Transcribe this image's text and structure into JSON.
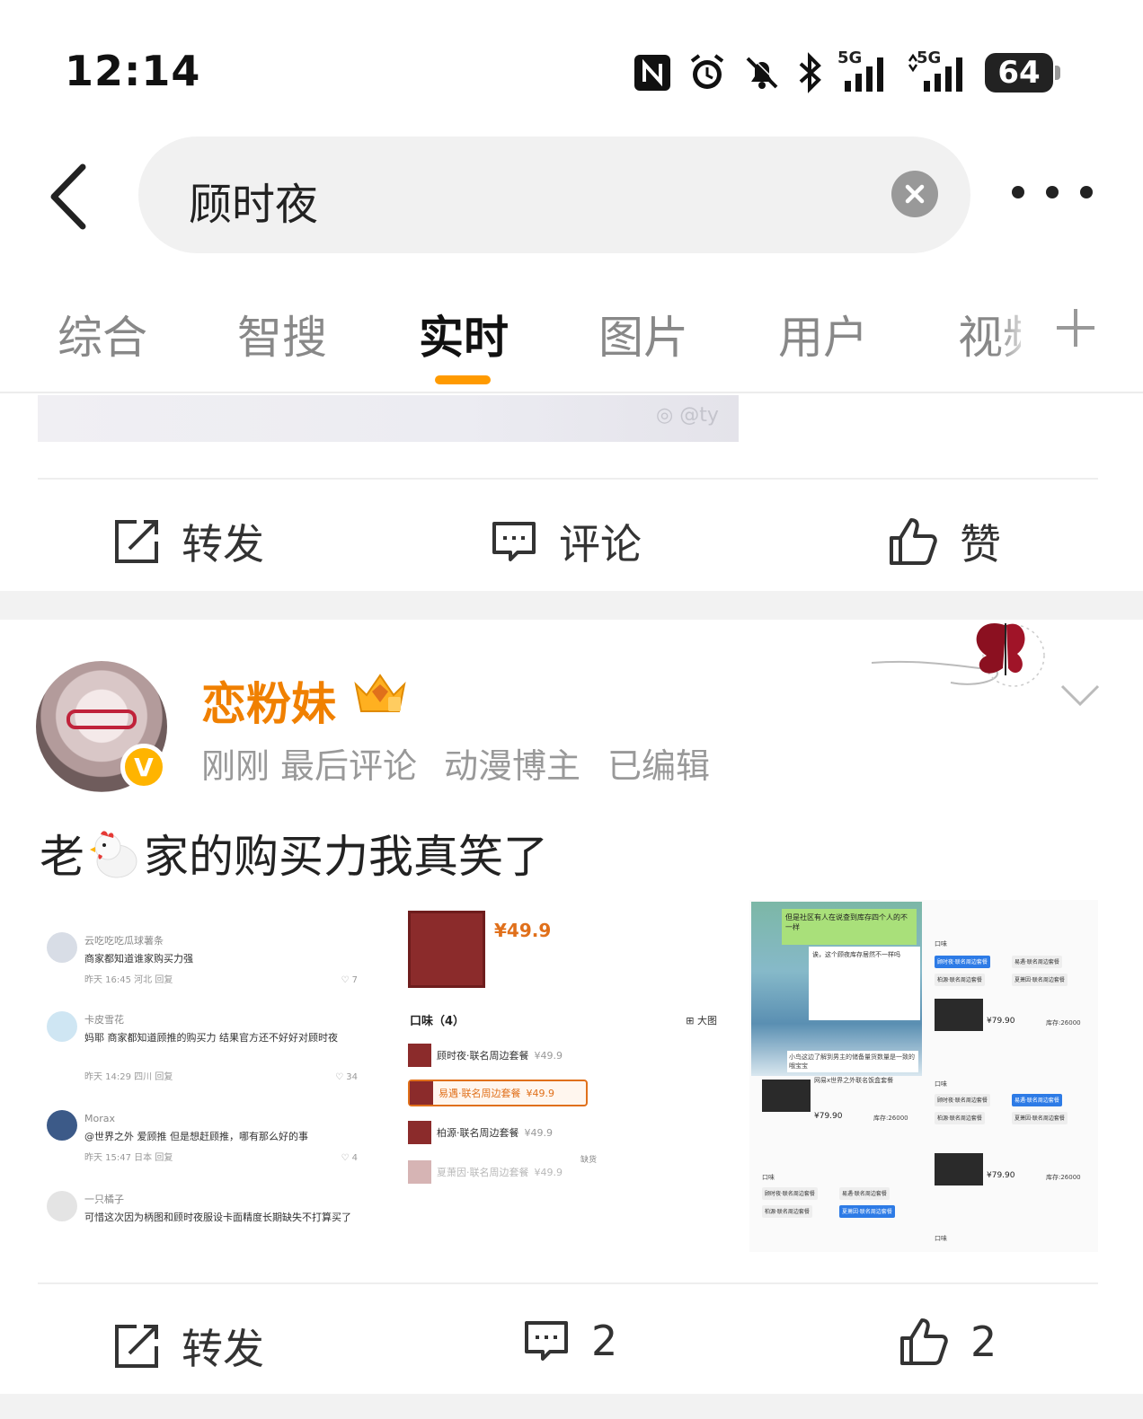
{
  "status_bar": {
    "time": "12:14",
    "icons": [
      "nfc-icon",
      "alarm-icon",
      "mute-icon",
      "bluetooth-icon",
      "signal-5g-icon",
      "signal-5g-data-icon"
    ],
    "network_1": "5G",
    "network_2": "5G",
    "battery": "64"
  },
  "search": {
    "query": "顾时夜"
  },
  "tabs": [
    {
      "label": "综合"
    },
    {
      "label": "智搜"
    },
    {
      "label": "实时",
      "active": true
    },
    {
      "label": "图片"
    },
    {
      "label": "用户"
    },
    {
      "label": "视频"
    }
  ],
  "accent_color": "#ff9a00",
  "previous_post": {
    "watermark": "@ty",
    "actions": {
      "repost": "转发",
      "comment": "评论",
      "like": "赞"
    }
  },
  "post": {
    "username": "恋粉妹",
    "username_color": "#f08000",
    "verified_badge": "V",
    "meta": {
      "time": "刚刚",
      "status": "最后评论",
      "role": "动漫博主",
      "edited": "已编辑"
    },
    "text_before": "老",
    "text_after": "家的购买力我真笑了",
    "emoji": "chicken-icon",
    "images": {
      "comments": [
        {
          "name": "云吃吃吃瓜球薯条",
          "body": "商家都知道谁家购买力强",
          "foot": "昨天 16:45 河北  回复",
          "likes": "7"
        },
        {
          "name": "卡皮雪花",
          "body": "妈耶 商家都知道顾推的购买力 结果官方还不好好对顾时夜",
          "foot": "昨天 14:29 四川  回复",
          "likes": "34"
        },
        {
          "name": "Morax",
          "body": "@世界之外 爱顾推 但是想赶顾推，哪有那么好的事",
          "foot": "昨天 15:47 日本  回复",
          "likes": "4"
        },
        {
          "name": "一只橘子",
          "body": "可惜这次因为柄图和顾时夜服设卡面精度长期缺失不打算买了",
          "foot": "",
          "likes": ""
        }
      ],
      "product": {
        "price": "¥49.9",
        "heading": "口味（4）",
        "big_view": "大图",
        "options": [
          {
            "label": "顾时夜·联名周边套餐",
            "price": "¥49.9"
          },
          {
            "label": "易遇·联名周边套餐",
            "price": "¥49.9"
          },
          {
            "label": "柏源·联名周边套餐",
            "price": "¥49.9"
          },
          {
            "label": "夏萧因·联名周边套餐",
            "price": "¥49.9"
          }
        ],
        "stock_note": "缺货"
      },
      "listing": {
        "bubble": "但是社区有人在说查到库存四个人的不一样",
        "card": "诶，这个顾夜库存居然不一样吗",
        "caption": "小鸟这边了解到男主的储备量货数量是一致的哦宝宝",
        "title": "网易x世界之外联名饭盒套餐",
        "price": "¥79.90",
        "stock": "库存:26000",
        "flavor": "口味",
        "tags": [
          "顾时夜·联名周边套餐",
          "易遇·联名周边套餐",
          "柏源·联名周边套餐",
          "夏萧因·联名周边套餐"
        ]
      }
    },
    "actions": {
      "repost": "转发",
      "comments": "2",
      "likes": "2"
    }
  }
}
